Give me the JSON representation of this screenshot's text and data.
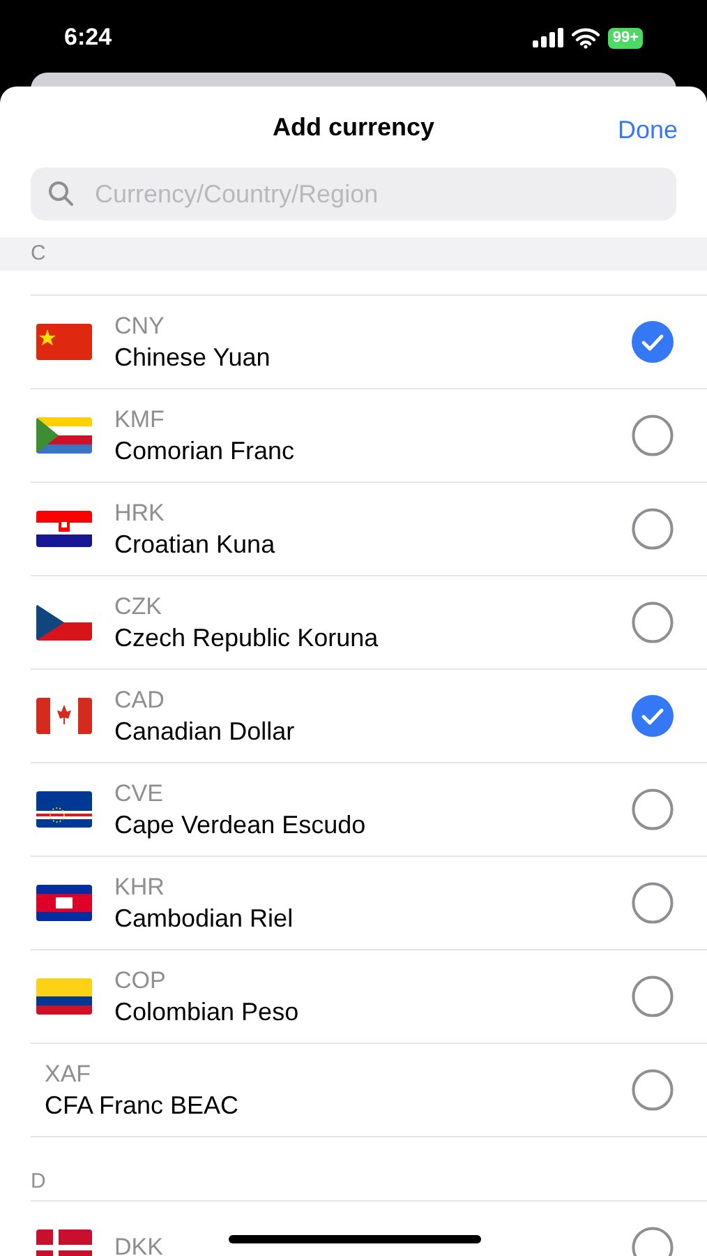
{
  "status_bar": {
    "time": "6:24",
    "battery": "99+"
  },
  "header": {
    "title": "Add currency",
    "done": "Done"
  },
  "search": {
    "placeholder": "Currency/Country/Region"
  },
  "sections": [
    {
      "letter": "C",
      "items": [
        {
          "code": "CNY",
          "name": "Chinese Yuan",
          "kind": "cn",
          "selected": true
        },
        {
          "code": "KMF",
          "name": "Comorian Franc",
          "kind": "km",
          "selected": false
        },
        {
          "code": "HRK",
          "name": "Croatian Kuna",
          "kind": "hr",
          "selected": false
        },
        {
          "code": "CZK",
          "name": "Czech Republic Koruna",
          "kind": "cz",
          "selected": false
        },
        {
          "code": "CAD",
          "name": "Canadian Dollar",
          "kind": "ca",
          "selected": true
        },
        {
          "code": "CVE",
          "name": "Cape Verdean Escudo",
          "kind": "cv",
          "selected": false
        },
        {
          "code": "KHR",
          "name": "Cambodian Riel",
          "kind": "kh",
          "selected": false
        },
        {
          "code": "COP",
          "name": "Colombian Peso",
          "kind": "co",
          "selected": false
        },
        {
          "code": "XAF",
          "name": "CFA Franc BEAC",
          "kind": "plain",
          "selected": false
        }
      ]
    },
    {
      "letter": "D",
      "items": [
        {
          "code": "DKK",
          "kind": "dk",
          "selected": false
        }
      ]
    }
  ]
}
